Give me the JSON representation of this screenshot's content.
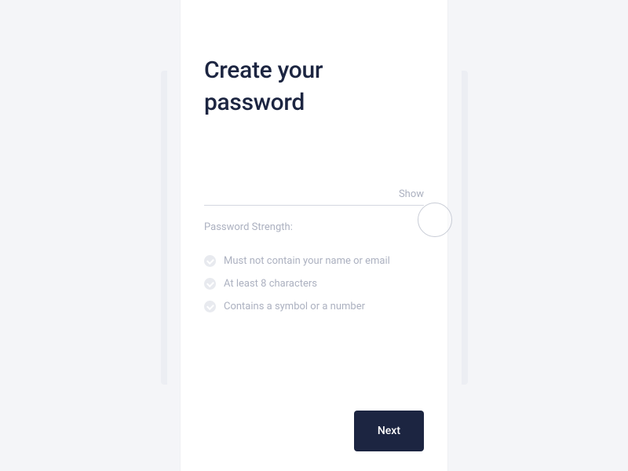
{
  "title": "Create your password",
  "password": {
    "value": "",
    "placeholder": ""
  },
  "showToggle": "Show",
  "strengthLabel": "Password Strength:",
  "requirements": [
    {
      "text": "Must not contain your name or email"
    },
    {
      "text": "At least 8 characters"
    },
    {
      "text": "Contains a symbol or a number"
    }
  ],
  "nextButton": "Next"
}
